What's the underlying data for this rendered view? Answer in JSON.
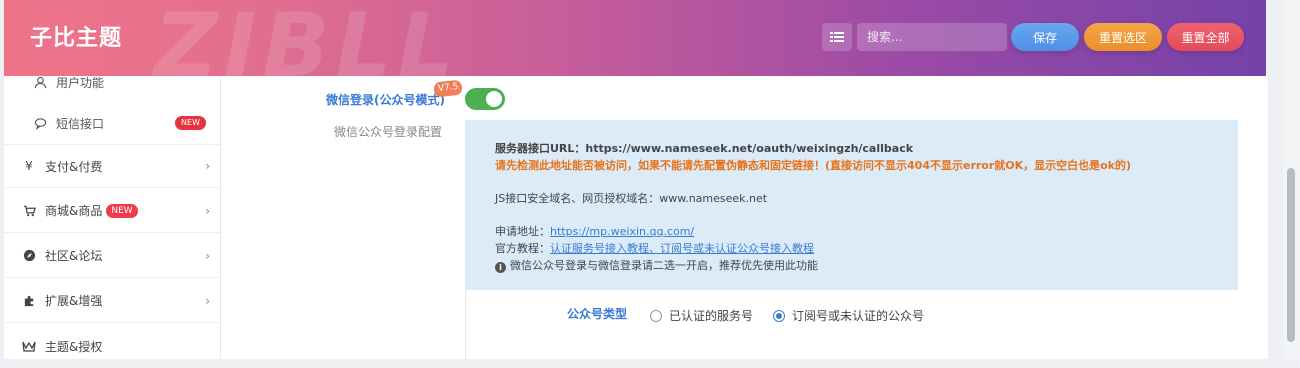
{
  "header": {
    "brand": "子比主题",
    "watermark": "ZIBLL",
    "search_placeholder": "搜索...",
    "save_label": "保存",
    "reset_section_label": "重置选区",
    "reset_all_label": "重置全部"
  },
  "sidebar": {
    "items": [
      {
        "label": "用户功能",
        "icon": "user-icon"
      },
      {
        "label": "短信接口",
        "icon": "message-icon",
        "badge": "NEW"
      },
      {
        "label": "支付&付费",
        "icon": "yen-icon"
      },
      {
        "label": "商城&商品",
        "icon": "cart-icon",
        "badge": "NEW"
      },
      {
        "label": "社区&论坛",
        "icon": "compass-icon"
      },
      {
        "label": "扩展&增强",
        "icon": "puzzle-icon"
      },
      {
        "label": "主题&授权",
        "icon": "theme-icon"
      }
    ]
  },
  "content": {
    "wechat_login_label": "微信登录(公众号模式)",
    "version_badge": "V7.5",
    "toggle_on": true,
    "sub_label": "微信公众号登录配置",
    "info": {
      "server_url_line": "服务器接口URL：https://www.nameseek.net/oauth/weixingzh/callback",
      "warning_line": "请先检测此地址能否被访问，如果不能请先配置伪静态和固定链接！(直接访问不显示404不显示error就OK，显示空白也是ok的)",
      "js_domain_line": "JS接口安全域名、网页授权域名：www.nameseek.net",
      "apply_prefix": "申请地址：",
      "apply_link": "https://mp.weixin.qq.com/",
      "tutorial_prefix": "官方教程：",
      "tutorial_link": "认证服务号接入教程、订阅号或未认证公众号接入教程",
      "notice_line": "微信公众号登录与微信登录请二选一开启，推荐优先使用此功能"
    },
    "account_type_label": "公众号类型",
    "options": [
      {
        "label": "已认证的服务号",
        "checked": false
      },
      {
        "label": "订阅号或未认证的公众号",
        "checked": true
      }
    ]
  }
}
